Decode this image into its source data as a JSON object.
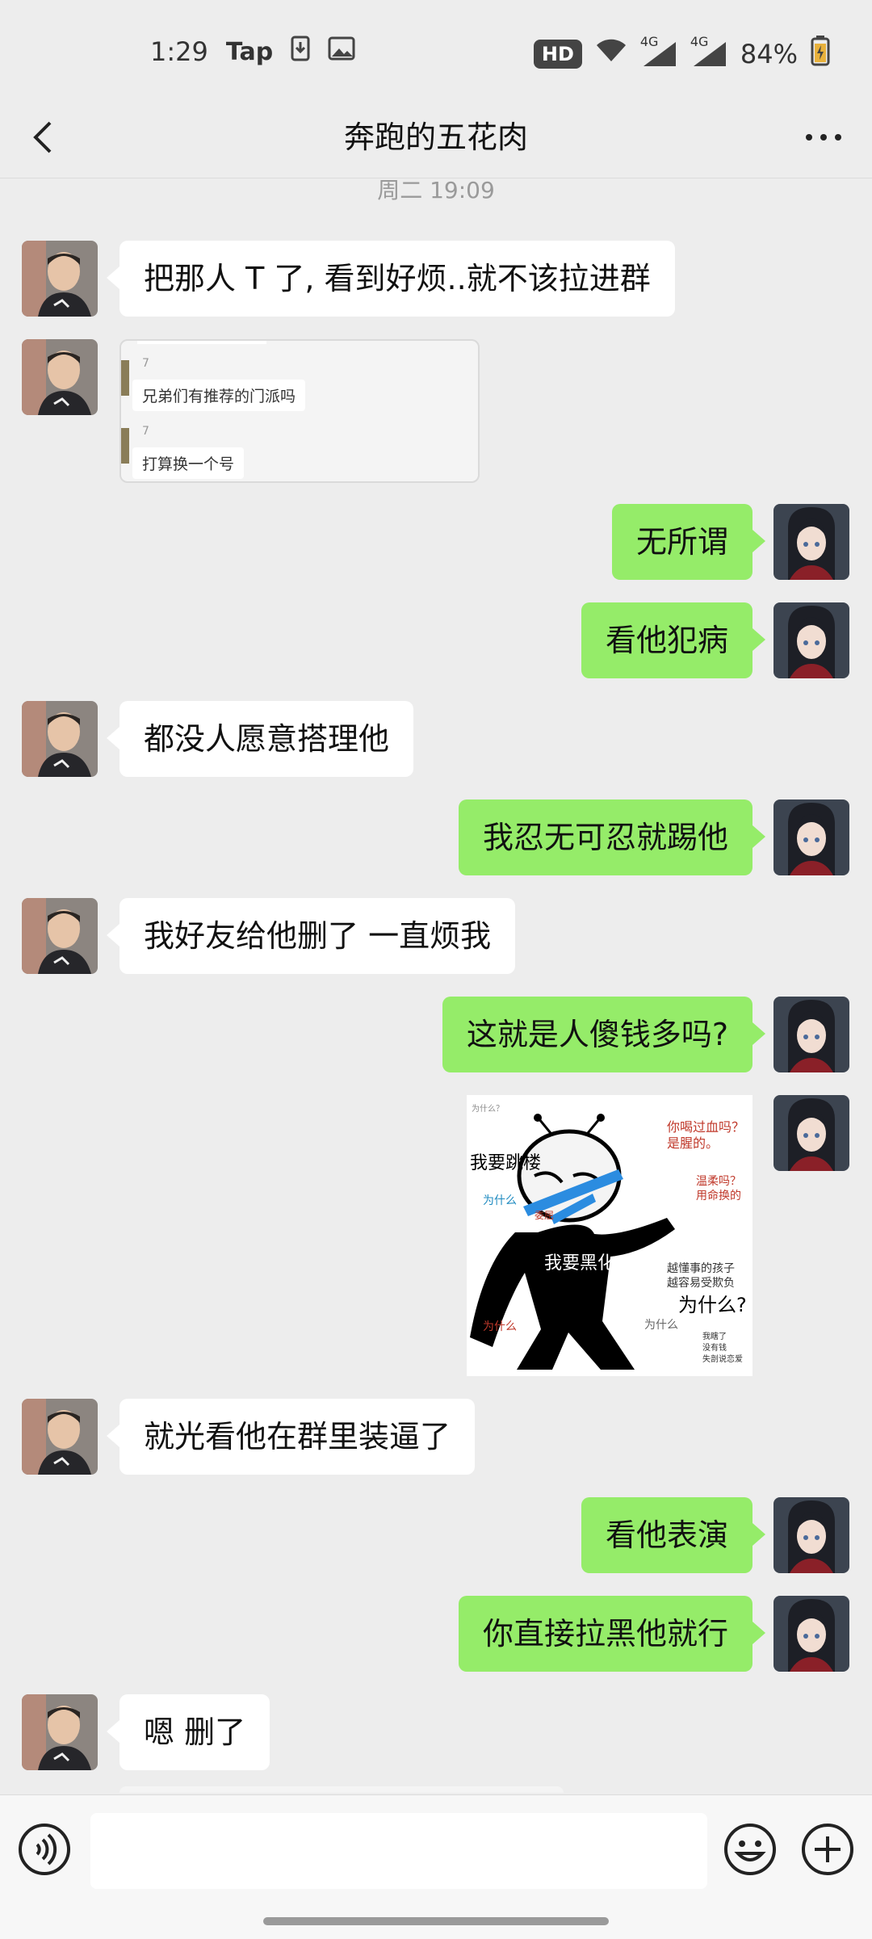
{
  "status_bar": {
    "time": "1:29",
    "app_label": "Tap",
    "hd_badge": "HD",
    "network_1": "4G",
    "network_2": "4G",
    "battery": "84%"
  },
  "header": {
    "title": "奔跑的五花肉"
  },
  "timestamp": "周二 19:09",
  "messages": [
    {
      "side": "them",
      "type": "text",
      "text": "把那人 T 了, 看到好烦..就不该拉进群"
    },
    {
      "side": "them",
      "type": "screenshot",
      "rows": [
        {
          "num": "7",
          "text": "兄弟们有推荐的门派吗"
        },
        {
          "num": "7",
          "text": "打算换一个号"
        }
      ]
    },
    {
      "side": "me",
      "type": "text",
      "text": "无所谓"
    },
    {
      "side": "me",
      "type": "text",
      "text": "看他犯病"
    },
    {
      "side": "them",
      "type": "text",
      "text": "都没人愿意搭理他"
    },
    {
      "side": "me",
      "type": "text",
      "text": "我忍无可忍就踢他"
    },
    {
      "side": "them",
      "type": "text",
      "text": "我好友给他删了 一直烦我"
    },
    {
      "side": "me",
      "type": "text",
      "text": "这就是人傻钱多吗?"
    },
    {
      "side": "me",
      "type": "sticker",
      "texts": {
        "t1": "为什么？",
        "t2": "我要跳楼",
        "t3": "你喝过血吗？",
        "t4": "是腥的。",
        "t5": "为什么",
        "t6": "委屈",
        "t7": "温柔吗？",
        "t8": "用命换的",
        "t9": "我要黑化",
        "t10": "越懂事的孩子",
        "t11": "越容易受欺负",
        "t12": "为什么?",
        "t13": "为什么",
        "t14": "为什么",
        "t15": "我瞎了",
        "t16": "没有钱",
        "t17": "失剖说恋爱"
      }
    },
    {
      "side": "them",
      "type": "text",
      "text": "就光看他在群里装逼了"
    },
    {
      "side": "me",
      "type": "text",
      "text": "看他表演"
    },
    {
      "side": "me",
      "type": "text",
      "text": "你直接拉黑他就行"
    },
    {
      "side": "them",
      "type": "text",
      "text": "嗯 删了"
    }
  ],
  "input": {
    "placeholder": ""
  },
  "colors": {
    "background": "#ededed",
    "my_bubble": "#95ec69",
    "their_bubble": "#ffffff"
  }
}
